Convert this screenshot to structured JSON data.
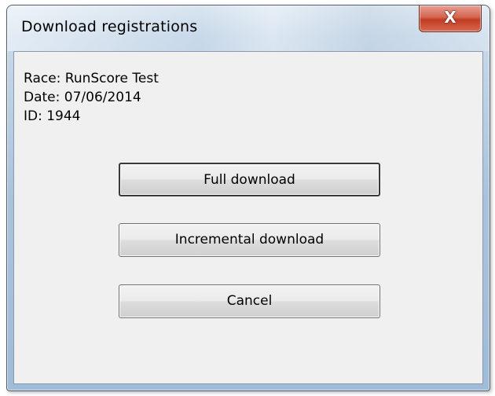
{
  "window": {
    "title": "Download registrations",
    "close_symbol": "X"
  },
  "info": {
    "race": "Race: RunScore Test",
    "date": "Date: 07/06/2014",
    "id": "ID: 1944"
  },
  "buttons": {
    "full_download": "Full download",
    "incremental_download": "Incremental download",
    "cancel": "Cancel"
  },
  "icons": {
    "close": "close-icon"
  },
  "colors": {
    "close_button": "#c94a35",
    "client_background": "#f0f0f0",
    "frame": "#a9c3dc"
  }
}
